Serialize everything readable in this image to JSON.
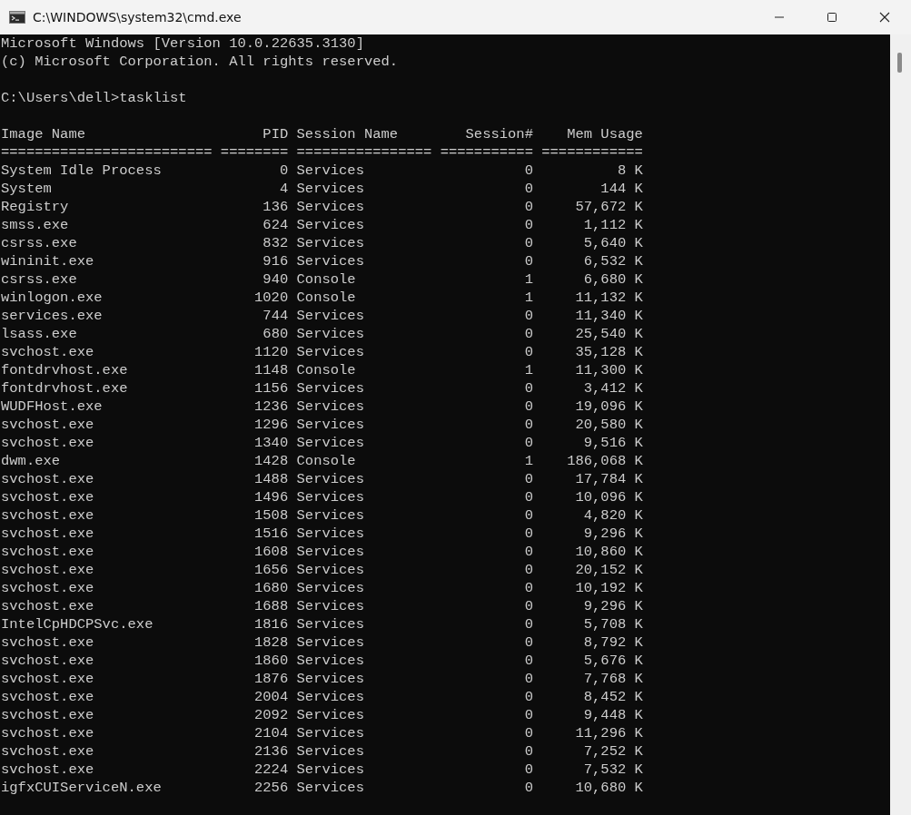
{
  "window": {
    "title": "C:\\WINDOWS\\system32\\cmd.exe"
  },
  "console": {
    "banner": [
      "Microsoft Windows [Version 10.0.22635.3130]",
      "(c) Microsoft Corporation. All rights reserved."
    ],
    "prompt": "C:\\Users\\dell>tasklist",
    "columns": [
      {
        "label": "Image Name",
        "rule": "========================="
      },
      {
        "label": "PID",
        "rule": "========"
      },
      {
        "label": "Session Name",
        "rule": "================"
      },
      {
        "label": "Session#",
        "rule": "==========="
      },
      {
        "label": "Mem Usage",
        "rule": "============"
      }
    ],
    "rows": [
      [
        "System Idle Process",
        "0",
        "Services",
        "0",
        "8 K"
      ],
      [
        "System",
        "4",
        "Services",
        "0",
        "144 K"
      ],
      [
        "Registry",
        "136",
        "Services",
        "0",
        "57,672 K"
      ],
      [
        "smss.exe",
        "624",
        "Services",
        "0",
        "1,112 K"
      ],
      [
        "csrss.exe",
        "832",
        "Services",
        "0",
        "5,640 K"
      ],
      [
        "wininit.exe",
        "916",
        "Services",
        "0",
        "6,532 K"
      ],
      [
        "csrss.exe",
        "940",
        "Console",
        "1",
        "6,680 K"
      ],
      [
        "winlogon.exe",
        "1020",
        "Console",
        "1",
        "11,132 K"
      ],
      [
        "services.exe",
        "744",
        "Services",
        "0",
        "11,340 K"
      ],
      [
        "lsass.exe",
        "680",
        "Services",
        "0",
        "25,540 K"
      ],
      [
        "svchost.exe",
        "1120",
        "Services",
        "0",
        "35,128 K"
      ],
      [
        "fontdrvhost.exe",
        "1148",
        "Console",
        "1",
        "11,300 K"
      ],
      [
        "fontdrvhost.exe",
        "1156",
        "Services",
        "0",
        "3,412 K"
      ],
      [
        "WUDFHost.exe",
        "1236",
        "Services",
        "0",
        "19,096 K"
      ],
      [
        "svchost.exe",
        "1296",
        "Services",
        "0",
        "20,580 K"
      ],
      [
        "svchost.exe",
        "1340",
        "Services",
        "0",
        "9,516 K"
      ],
      [
        "dwm.exe",
        "1428",
        "Console",
        "1",
        "186,068 K"
      ],
      [
        "svchost.exe",
        "1488",
        "Services",
        "0",
        "17,784 K"
      ],
      [
        "svchost.exe",
        "1496",
        "Services",
        "0",
        "10,096 K"
      ],
      [
        "svchost.exe",
        "1508",
        "Services",
        "0",
        "4,820 K"
      ],
      [
        "svchost.exe",
        "1516",
        "Services",
        "0",
        "9,296 K"
      ],
      [
        "svchost.exe",
        "1608",
        "Services",
        "0",
        "10,860 K"
      ],
      [
        "svchost.exe",
        "1656",
        "Services",
        "0",
        "20,152 K"
      ],
      [
        "svchost.exe",
        "1680",
        "Services",
        "0",
        "10,192 K"
      ],
      [
        "svchost.exe",
        "1688",
        "Services",
        "0",
        "9,296 K"
      ],
      [
        "IntelCpHDCPSvc.exe",
        "1816",
        "Services",
        "0",
        "5,708 K"
      ],
      [
        "svchost.exe",
        "1828",
        "Services",
        "0",
        "8,792 K"
      ],
      [
        "svchost.exe",
        "1860",
        "Services",
        "0",
        "5,676 K"
      ],
      [
        "svchost.exe",
        "1876",
        "Services",
        "0",
        "7,768 K"
      ],
      [
        "svchost.exe",
        "2004",
        "Services",
        "0",
        "8,452 K"
      ],
      [
        "svchost.exe",
        "2092",
        "Services",
        "0",
        "9,448 K"
      ],
      [
        "svchost.exe",
        "2104",
        "Services",
        "0",
        "11,296 K"
      ],
      [
        "svchost.exe",
        "2136",
        "Services",
        "0",
        "7,252 K"
      ],
      [
        "svchost.exe",
        "2224",
        "Services",
        "0",
        "7,532 K"
      ],
      [
        "igfxCUIServiceN.exe",
        "2256",
        "Services",
        "0",
        "10,680 K"
      ]
    ]
  }
}
